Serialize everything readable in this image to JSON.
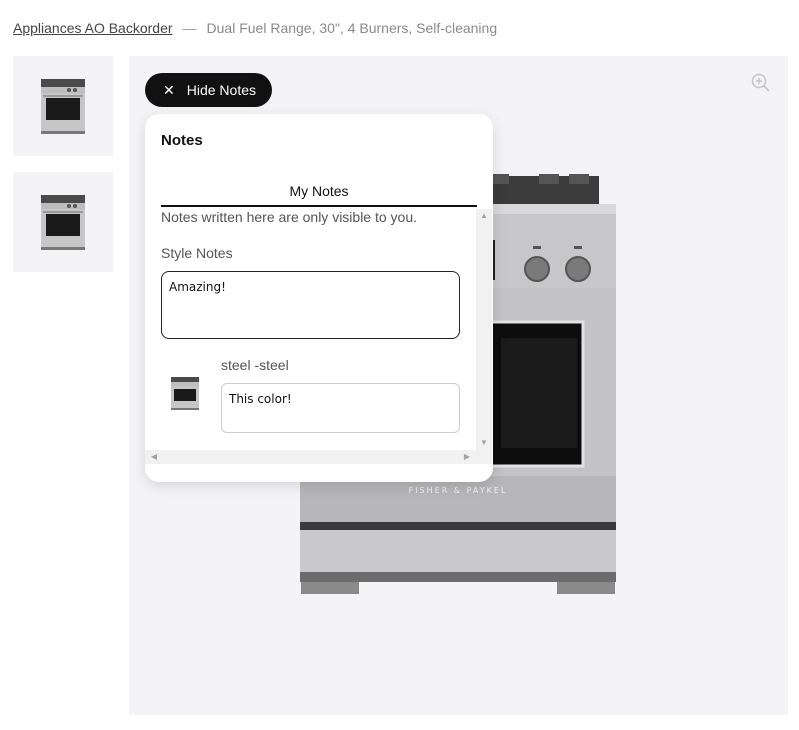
{
  "breadcrumb": {
    "link_label": "Appliances AO Backorder",
    "separator": "—",
    "current": "Dual Fuel Range, 30\", 4 Burners, Self-cleaning"
  },
  "gallery": {
    "thumbnails": [
      "range-product-image",
      "range-product-image"
    ],
    "zoom_icon": "zoom-in-icon",
    "brand_mark": "FISHER & PAYKEL"
  },
  "notes_toggle": {
    "icon": "close-icon",
    "label": "Hide Notes"
  },
  "notes": {
    "title": "Notes",
    "tabs": [
      {
        "label": "My Notes",
        "active": true
      }
    ],
    "privacy_text": "Notes written here are only visible to you.",
    "style_notes_label": "Style Notes",
    "style_notes_value": "Amazing!",
    "items": [
      {
        "name": "steel -steel",
        "note_value": "This color!"
      }
    ]
  },
  "colors": {
    "button_bg": "#111111",
    "stage_bg": "#f4f4f6",
    "panel_bg": "#ffffff"
  }
}
